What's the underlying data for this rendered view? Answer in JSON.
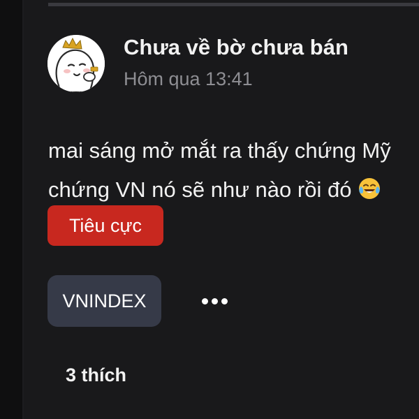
{
  "post": {
    "author_name": "Chưa về bờ chưa bán",
    "timestamp": "Hôm qua 13:41",
    "content_line1": "mai sáng mở mắt ra thấy chứng Mỹ",
    "content_line2": "chứng VN nó sẽ như nào rồi đó",
    "content_emoji": "face-with-tears-of-joy-icon",
    "sentiment_label": "Tiêu cực",
    "tags": [
      "VNINDEX"
    ],
    "more_icon": "more-horizontal-icon",
    "likes_text": "3 thích",
    "avatar_icon": "crowned-blob-avatar",
    "colors": {
      "negative_badge": "#c8281f",
      "tag_chip": "#363a48",
      "background": "#19191b"
    }
  }
}
